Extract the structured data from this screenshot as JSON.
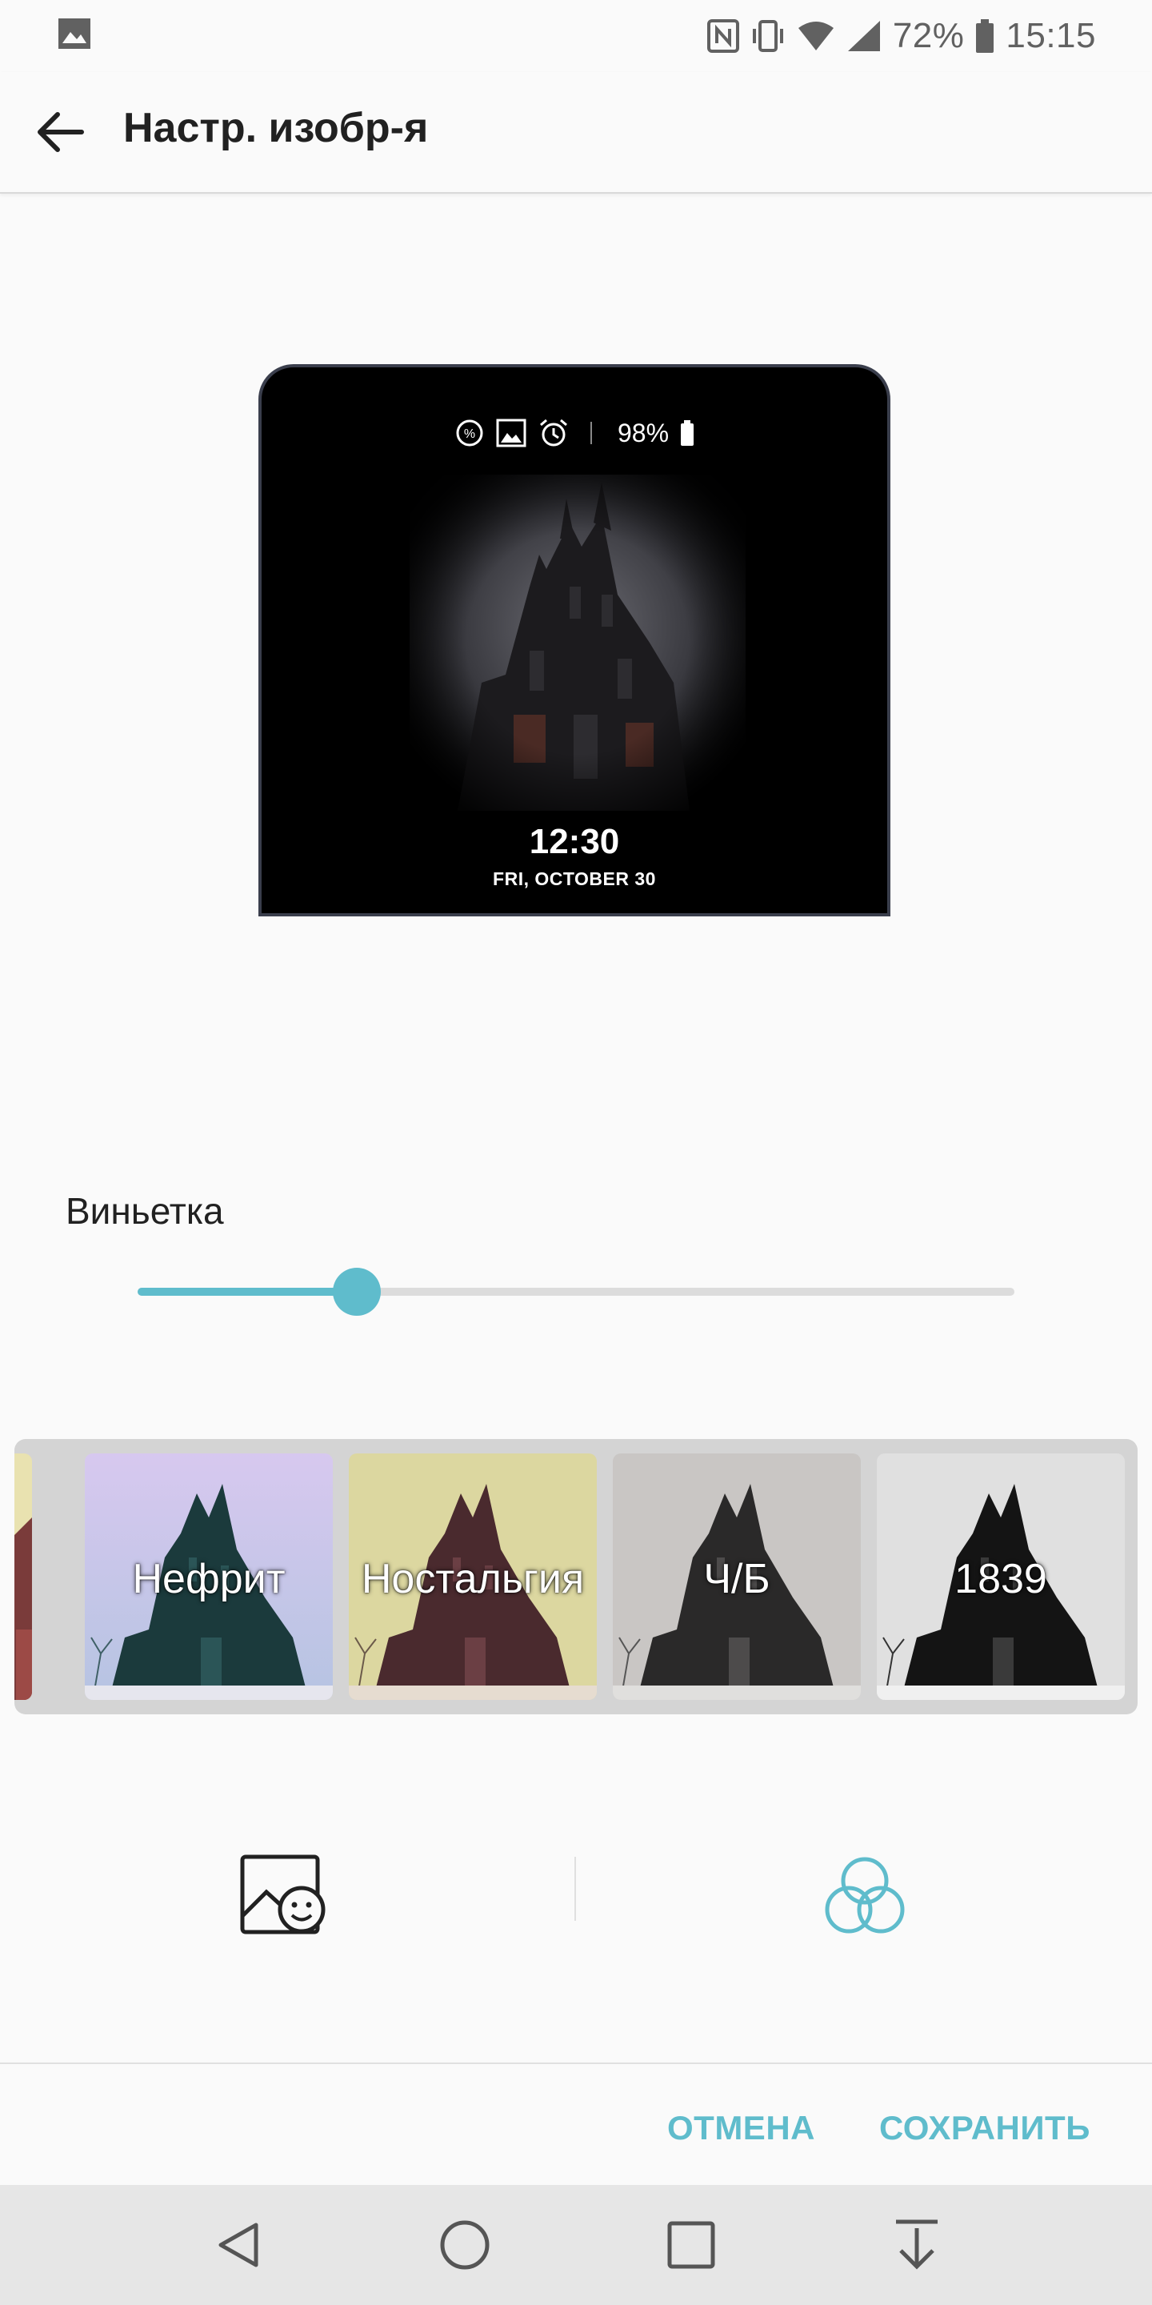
{
  "status_bar": {
    "battery_percent": "72%",
    "time": "15:15",
    "icons": [
      "gallery-notification-icon",
      "nfc-icon",
      "vibrate-icon",
      "wifi-icon",
      "signal-icon",
      "battery-icon"
    ]
  },
  "app_bar": {
    "title": "Настр. изобр-я"
  },
  "preview": {
    "battery": "98%",
    "time": "12:30",
    "date": "FRI, OCTOBER 30",
    "status_icons": [
      "data-saver-icon",
      "gallery-icon",
      "alarm-icon",
      "battery-icon"
    ]
  },
  "vignette": {
    "label": "Виньетка",
    "value_fraction": 0.25
  },
  "filters": [
    {
      "label": "",
      "tint": "warm"
    },
    {
      "label": "Нефрит",
      "tint": "jade"
    },
    {
      "label": "Ностальгия",
      "tint": "nostalgia"
    },
    {
      "label": "Ч/Б",
      "tint": "bw"
    },
    {
      "label": "1839",
      "tint": "1839"
    }
  ],
  "modes": {
    "photo": "photo-sticker-icon",
    "filters": "filters-icon"
  },
  "actions": {
    "cancel": "ОТМЕНА",
    "save": "СОХРАНИТЬ"
  },
  "colors": {
    "accent": "#5fbccc",
    "nav_bar": "#e6e6e6"
  }
}
